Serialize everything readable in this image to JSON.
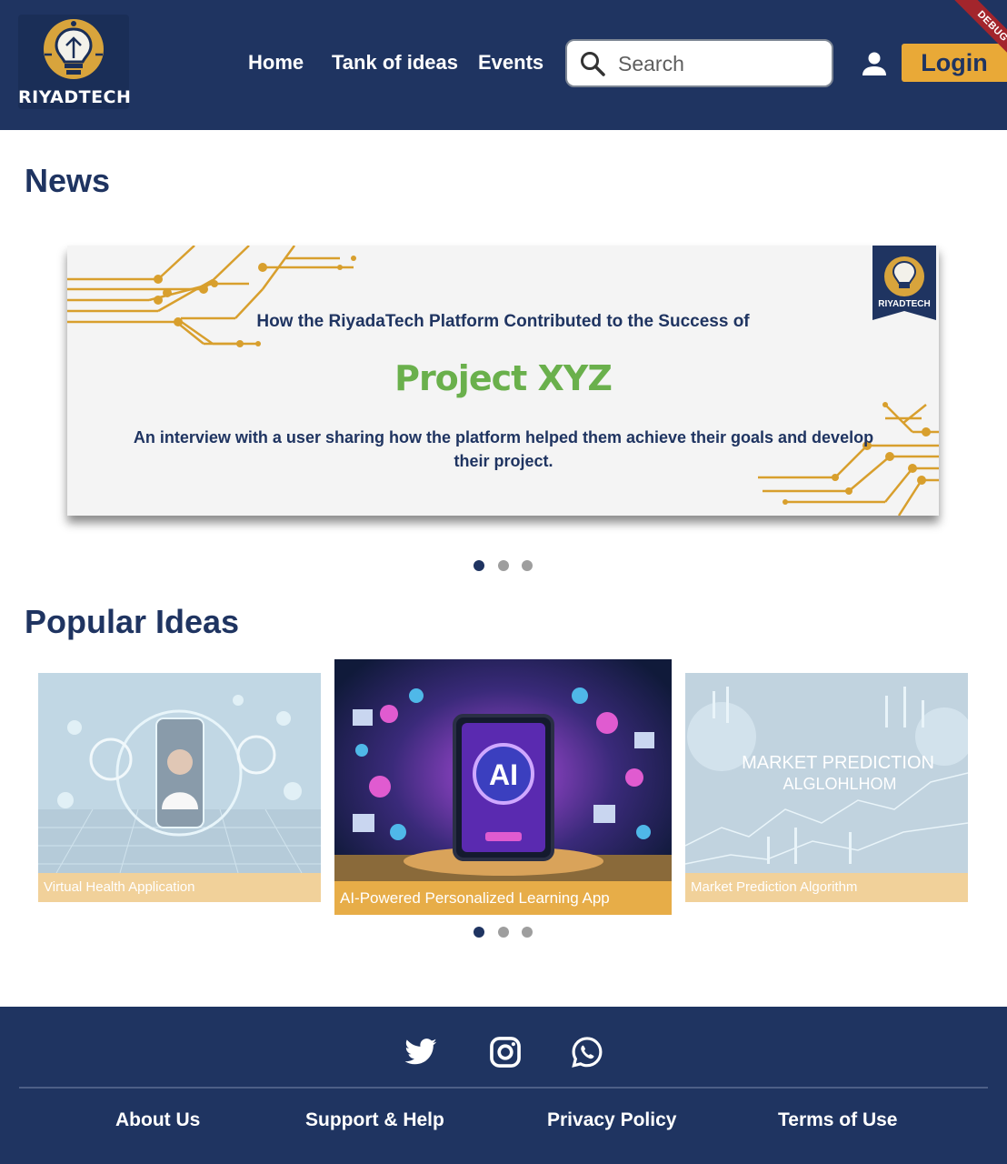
{
  "header": {
    "logo_text": "RIYADTECH",
    "nav": {
      "home": "Home",
      "tank": "Tank of ideas",
      "events": "Events"
    },
    "search": {
      "placeholder": "Search"
    },
    "login_label": "Login",
    "debug_label": "DEBUG"
  },
  "news": {
    "title": "News",
    "slide": {
      "headline": "How the RiyadaTech Platform Contributed to the Success of",
      "project": "Project XYZ",
      "description": "An interview with a user sharing how the platform helped them achieve their goals and develop their project.",
      "badge_text": "RIYADTECH"
    },
    "carousel": {
      "count": 3,
      "active": 0
    }
  },
  "popular": {
    "title": "Popular Ideas",
    "cards": [
      {
        "caption": "Virtual Health Application"
      },
      {
        "caption": "AI-Powered Personalized Learning App",
        "image_text": "AI"
      },
      {
        "caption": "Market Prediction Algorithm",
        "image_text": "MARKET PREDICTION ALGLOHLHOM"
      }
    ],
    "carousel": {
      "count": 3,
      "active": 0
    }
  },
  "footer": {
    "social": [
      "twitter-icon",
      "instagram-icon",
      "whatsapp-icon"
    ],
    "links": {
      "about": "About Us",
      "support": "Support & Help",
      "privacy": "Privacy Policy",
      "terms": "Terms of Use"
    }
  },
  "colors": {
    "primary": "#1f3461",
    "accent": "#e9a937",
    "project_green": "#6ab04c",
    "debug_red": "#a3252c"
  }
}
